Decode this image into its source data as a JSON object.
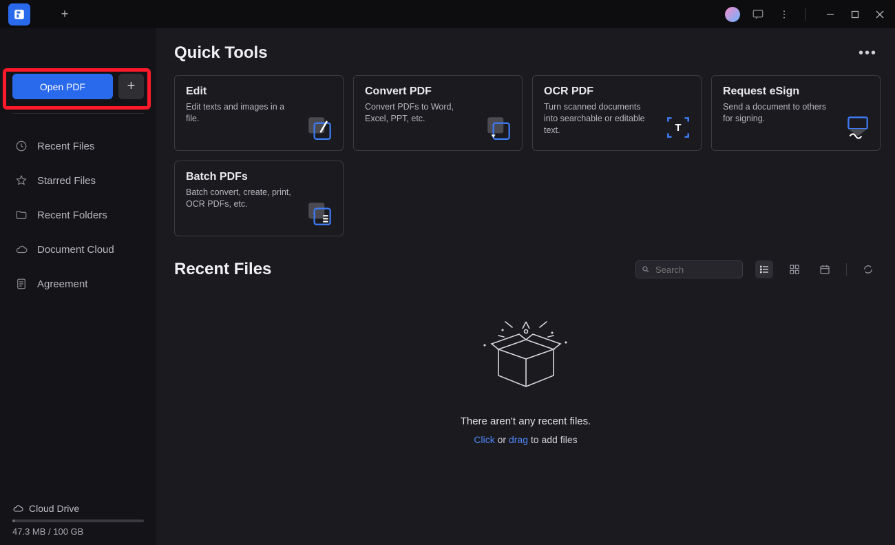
{
  "titlebar": {
    "new_tab_plus": "+"
  },
  "sidebar": {
    "open_pdf_label": "Open PDF",
    "plus": "+",
    "items": [
      {
        "label": "Recent Files"
      },
      {
        "label": "Starred Files"
      },
      {
        "label": "Recent Folders"
      },
      {
        "label": "Document Cloud"
      },
      {
        "label": "Agreement"
      }
    ],
    "cloud": {
      "title": "Cloud Drive",
      "usage": "47.3 MB / 100 GB"
    }
  },
  "quick_tools": {
    "heading": "Quick Tools",
    "more": "•••",
    "cards": [
      {
        "title": "Edit",
        "desc": "Edit texts and images in a file."
      },
      {
        "title": "Convert PDF",
        "desc": "Convert PDFs to Word, Excel, PPT, etc."
      },
      {
        "title": "OCR PDF",
        "desc": "Turn scanned documents into searchable or editable text."
      },
      {
        "title": "Request eSign",
        "desc": "Send a document to others for signing."
      },
      {
        "title": "Batch PDFs",
        "desc": "Batch convert, create, print, OCR PDFs, etc."
      }
    ]
  },
  "recent": {
    "heading": "Recent Files",
    "search_placeholder": "Search",
    "empty_msg": "There aren't any recent files.",
    "empty_click": "Click",
    "empty_or": " or ",
    "empty_drag": "drag",
    "empty_tail": " to add files"
  }
}
